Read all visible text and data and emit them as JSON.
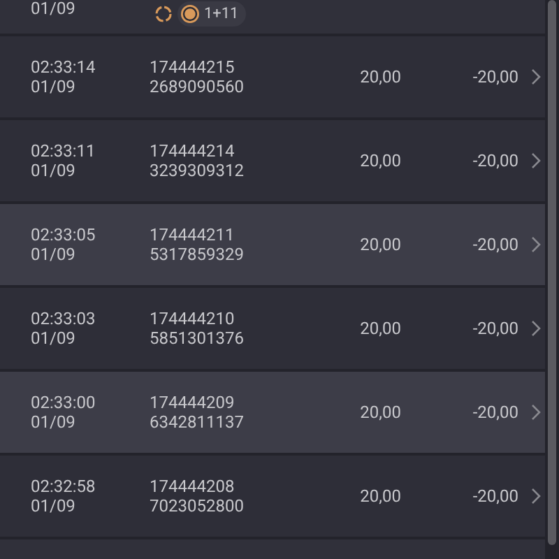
{
  "top_row": {
    "date": "01/09",
    "badge": "1+11"
  },
  "rows": [
    {
      "time": "02:33:14",
      "date": "01/09",
      "id_1": "174444215",
      "id_2": "2689090560",
      "amount": "20,00",
      "total": "-20,00",
      "shaded": false
    },
    {
      "time": "02:33:11",
      "date": "01/09",
      "id_1": "174444214",
      "id_2": "3239309312",
      "amount": "20,00",
      "total": "-20,00",
      "shaded": false
    },
    {
      "time": "02:33:05",
      "date": "01/09",
      "id_1": "174444211",
      "id_2": "5317859329",
      "amount": "20,00",
      "total": "-20,00",
      "shaded": true
    },
    {
      "time": "02:33:03",
      "date": "01/09",
      "id_1": "174444210",
      "id_2": "5851301376",
      "amount": "20,00",
      "total": "-20,00",
      "shaded": false
    },
    {
      "time": "02:33:00",
      "date": "01/09",
      "id_1": "174444209",
      "id_2": "6342811137",
      "amount": "20,00",
      "total": "-20,00",
      "shaded": true
    },
    {
      "time": "02:32:58",
      "date": "01/09",
      "id_1": "174444208",
      "id_2": "7023052800",
      "amount": "20,00",
      "total": "-20,00",
      "shaded": false
    }
  ]
}
